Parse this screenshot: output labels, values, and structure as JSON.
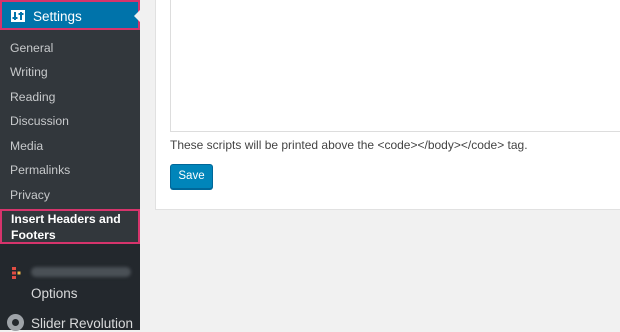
{
  "sidebar": {
    "settings_label": "Settings",
    "items": [
      {
        "label": "General"
      },
      {
        "label": "Writing"
      },
      {
        "label": "Reading"
      },
      {
        "label": "Discussion"
      },
      {
        "label": "Media"
      },
      {
        "label": "Permalinks"
      },
      {
        "label": "Privacy"
      }
    ],
    "current_item": {
      "line1": "Insert Headers and",
      "line2": "Footers"
    },
    "plugin_menu_label": "Options",
    "slider_menu_label": "Slider Revolution"
  },
  "main": {
    "description": "These scripts will be printed above the <code></body></code> tag.",
    "save_label": "Save"
  },
  "colors": {
    "sidebar_bg": "#23282d",
    "submenu_bg": "#32373c",
    "accent": "#0073aa",
    "highlight_border": "#d6346c",
    "button": "#0085ba"
  }
}
